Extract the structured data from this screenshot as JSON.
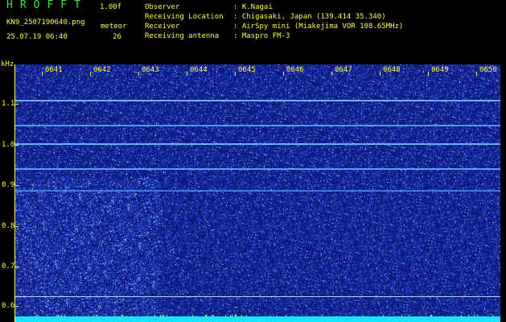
{
  "header": {
    "app_name": "HROFFT",
    "version": "1.00f",
    "filename": "KN9_2507190640.png",
    "meteor_label": "meteor",
    "timestamp": "25.07.19 06:40",
    "meteor_count": "26",
    "meta": [
      {
        "label": "Observer",
        "value": ": K.Nagai"
      },
      {
        "label": "Receiving Location",
        "value": ": Chigasaki, Japan (139.414 35.340)"
      },
      {
        "label": "Receiver",
        "value": ": AirSpy mini (Miakejima VOR 108.65MHz)"
      },
      {
        "label": "Receiving antenna",
        "value": ": Maspro FM-3"
      }
    ]
  },
  "spectrogram": {
    "y_unit": "kHz",
    "y_ticks": [
      "1.1",
      "1.0",
      "0.9",
      "0.8",
      "0.7",
      "0.6"
    ],
    "time_ticks": [
      "0641",
      "0642",
      "0643",
      "0644",
      "0645",
      "0646",
      "0647",
      "0648",
      "0649",
      "0650"
    ],
    "colors": {
      "background": "#0a0f7a",
      "noise": "#3a4fd0",
      "tone": "#7ec8ff",
      "baseline": "#13e7ff",
      "axis": "#fffb40"
    }
  }
}
